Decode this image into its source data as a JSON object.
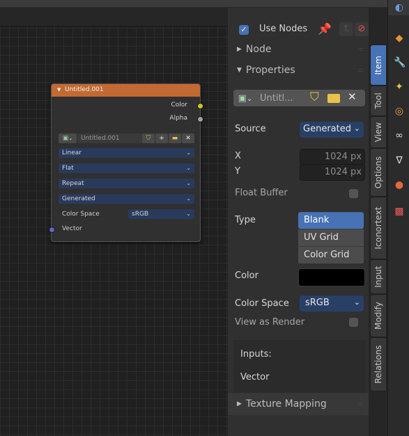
{
  "node": {
    "title": "Untitled.001",
    "outputs": [
      "Color",
      "Alpha"
    ],
    "image_name": "Untitled.001",
    "dropdowns": [
      "Linear",
      "Flat",
      "Repeat",
      "Generated"
    ],
    "color_space_label": "Color Space",
    "color_space_value": "sRGB",
    "input": "Vector"
  },
  "sidebar": {
    "use_nodes_label": "Use Nodes",
    "panel_node": "Node",
    "panel_properties": "Properties",
    "image_name": "Untitl...",
    "source_label": "Source",
    "source_value": "Generated",
    "x_label": "X",
    "x_value": "1024 px",
    "y_label": "Y",
    "y_value": "1024 px",
    "float_buffer_label": "Float Buffer",
    "type_label": "Type",
    "type_options": [
      "Blank",
      "UV Grid",
      "Color Grid"
    ],
    "type_selected": "Blank",
    "color_label": "Color",
    "color_value": "#000000",
    "color_space_label": "Color Space",
    "color_space_value": "sRGB",
    "view_as_render_label": "View as Render",
    "inputs_label": "Inputs:",
    "vector_label": "Vector",
    "texture_mapping": "Texture Mapping"
  },
  "tabs": [
    "Item",
    "Tool",
    "View",
    "Options",
    "Iconortext",
    "Input",
    "Modify",
    "Relations"
  ],
  "active_tab": "Item",
  "colors": {
    "node_header": "#c26a32",
    "accent": "#4772b3",
    "color_socket": "#c7c729",
    "float_socket": "#a1a1a1",
    "vector_socket": "#6363c7"
  }
}
